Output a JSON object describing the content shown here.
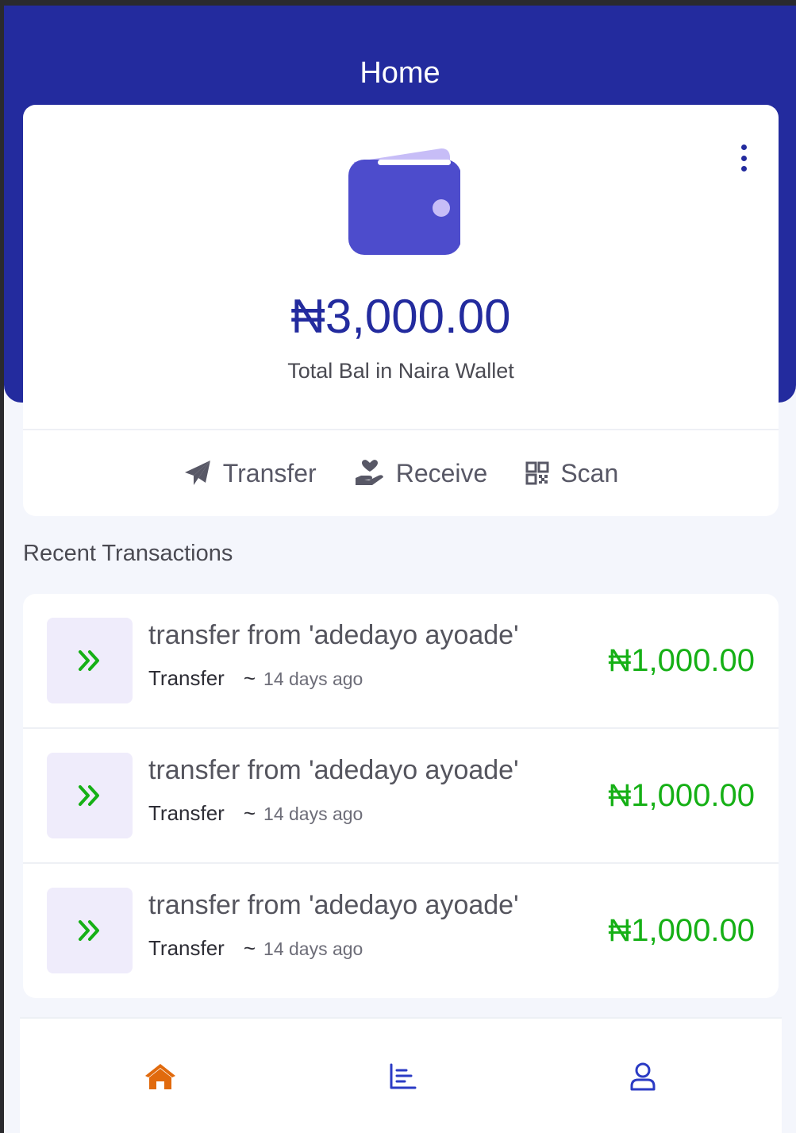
{
  "header": {
    "title": "Home"
  },
  "wallet": {
    "balance": "₦3,000.00",
    "balance_label": "Total Bal in Naira Wallet",
    "icon": "wallet-icon",
    "menu_icon": "kebab-menu-icon"
  },
  "actions": [
    {
      "label": "Transfer",
      "icon": "paper-plane-icon"
    },
    {
      "label": "Receive",
      "icon": "hand-holding-heart-icon"
    },
    {
      "label": "Scan",
      "icon": "qr-code-icon"
    }
  ],
  "recent": {
    "title": "Recent Transactions",
    "items": [
      {
        "title": "transfer from 'adedayo ayoade'",
        "type": "Transfer",
        "separator": "~",
        "time": "14 days ago",
        "amount": "₦1,000.00",
        "icon": "double-chevron-right-icon"
      },
      {
        "title": "transfer from 'adedayo ayoade'",
        "type": "Transfer",
        "separator": "~",
        "time": "14 days ago",
        "amount": "₦1,000.00",
        "icon": "double-chevron-right-icon"
      },
      {
        "title": "transfer from 'adedayo ayoade'",
        "type": "Transfer",
        "separator": "~",
        "time": "14 days ago",
        "amount": "₦1,000.00",
        "icon": "double-chevron-right-icon"
      }
    ]
  },
  "nav": [
    {
      "name": "home",
      "icon": "home-icon",
      "active": true
    },
    {
      "name": "stats",
      "icon": "bar-chart-icon",
      "active": false
    },
    {
      "name": "profile",
      "icon": "user-icon",
      "active": false
    }
  ],
  "colors": {
    "primary": "#232b9e",
    "wallet_body": "#4d4ccc",
    "wallet_flap": "#c7bdf7",
    "credit_green": "#16b016",
    "active_nav": "#e16a0d",
    "background": "#f4f6fc"
  }
}
